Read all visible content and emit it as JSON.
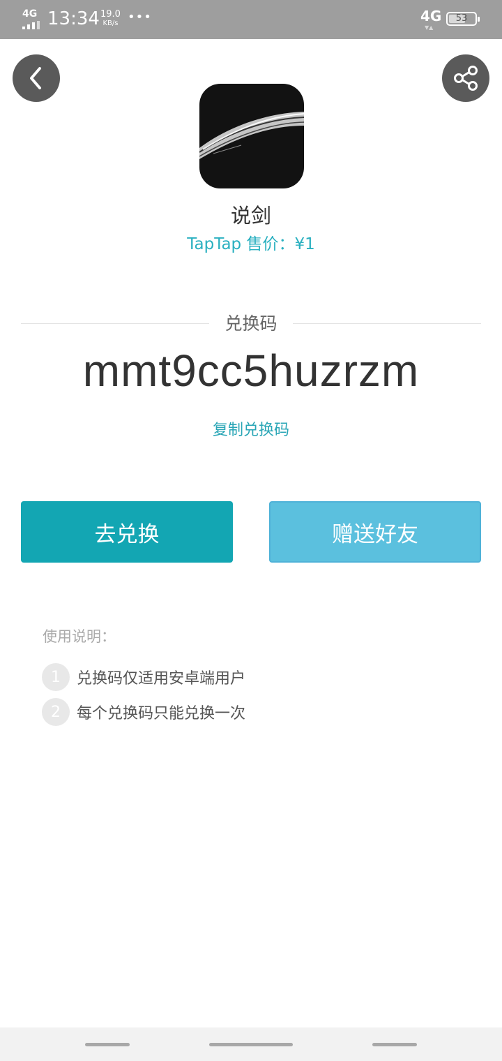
{
  "status_bar": {
    "network_left": "4G",
    "time": "13:34",
    "speed_value": "19.0",
    "speed_unit": "KB/s",
    "more": "•••",
    "network_right": "4G",
    "battery": "53"
  },
  "header": {
    "back_icon": "chevron-left-icon",
    "share_icon": "share-icon"
  },
  "app": {
    "name": "说剑",
    "price_label": "TapTap 售价：",
    "price_value": "¥1"
  },
  "redeem": {
    "section_label": "兑换码",
    "code": "mmt9cc5huzrzm",
    "copy_label": "复制兑换码"
  },
  "actions": {
    "redeem_button": "去兑换",
    "gift_button": "赠送好友"
  },
  "instructions": {
    "title": "使用说明：",
    "items": [
      {
        "num": "1",
        "text": "兑换码仅适用安卓端用户"
      },
      {
        "num": "2",
        "text": "每个兑换码只能兑换一次"
      }
    ]
  },
  "colors": {
    "accent": "#13a6b3",
    "gift": "#5bc0de",
    "price_text": "#2ab0c0",
    "status_bar": "#9e9e9e"
  }
}
